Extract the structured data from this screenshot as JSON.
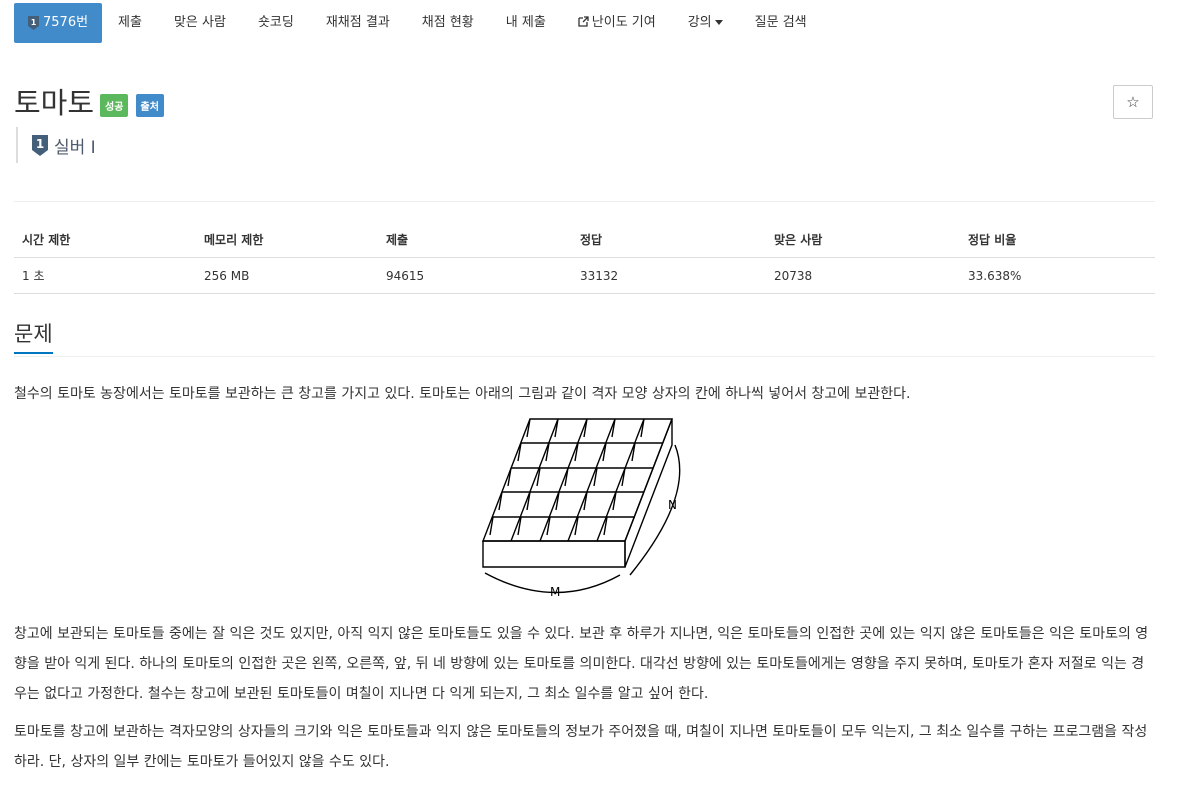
{
  "nav": {
    "problem_id": "7576번",
    "items": [
      "제출",
      "맞은 사람",
      "숏코딩",
      "재채점 결과",
      "채점 현황",
      "내 제출",
      "난이도 기여",
      "강의",
      "질문 검색"
    ]
  },
  "title": "토마토",
  "labels": {
    "success": "성공",
    "source": "출처"
  },
  "tier": {
    "text": "실버 I",
    "icon": "silver-1-icon"
  },
  "star": {
    "glyph": "☆"
  },
  "info_table": {
    "headers": [
      "시간 제한",
      "메모리 제한",
      "제출",
      "정답",
      "맞은 사람",
      "정답 비율"
    ],
    "values": [
      "1 초",
      "256 MB",
      "94615",
      "33132",
      "20738",
      "33.638%"
    ]
  },
  "section": {
    "title": "문제"
  },
  "figure": {
    "label_n": "N",
    "label_m": "M"
  },
  "paragraphs": [
    "철수의 토마토 농장에서는 토마토를 보관하는 큰 창고를 가지고 있다. 토마토는 아래의 그림과 같이 격자 모양 상자의 칸에 하나씩 넣어서 창고에 보관한다.",
    "창고에 보관되는 토마토들 중에는 잘 익은 것도 있지만, 아직 익지 않은 토마토들도 있을 수 있다. 보관 후 하루가 지나면, 익은 토마토들의 인접한 곳에 있는 익지 않은 토마토들은 익은 토마토의 영향을 받아 익게 된다. 하나의 토마토의 인접한 곳은 왼쪽, 오른쪽, 앞, 뒤 네 방향에 있는 토마토를 의미한다. 대각선 방향에 있는 토마토들에게는 영향을 주지 못하며, 토마토가 혼자 저절로 익는 경우는 없다고 가정한다. 철수는 창고에 보관된 토마토들이 며칠이 지나면 다 익게 되는지, 그 최소 일수를 알고 싶어 한다.",
    "토마토를 창고에 보관하는 격자모양의 상자들의 크기와 익은 토마토들과 익지 않은 토마토들의 정보가 주어졌을 때, 며칠이 지나면 토마토들이 모두 익는지, 그 최소 일수를 구하는 프로그램을 작성하라. 단, 상자의 일부 칸에는 토마토가 들어있지 않을 수도 있다."
  ],
  "colors": {
    "accent": "#428bca",
    "success": "#5cb85c",
    "section_underline": "#0076c0",
    "tier": "#4c5a6b"
  }
}
